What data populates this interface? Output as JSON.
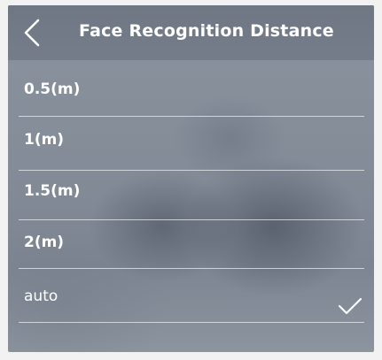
{
  "header": {
    "title": "Face Recognition Distance",
    "back_icon": "chevron-left-icon"
  },
  "options": [
    {
      "label": "0.5(m)",
      "selected": false
    },
    {
      "label": "1(m)",
      "selected": false
    },
    {
      "label": "1.5(m)",
      "selected": false
    },
    {
      "label": "2(m)",
      "selected": false
    },
    {
      "label": "auto",
      "selected": true
    }
  ],
  "selected_icon": "checkmark-icon",
  "colors": {
    "header_bg": "#727a87",
    "text": "#ffffff",
    "divider": "#ebeef2"
  }
}
